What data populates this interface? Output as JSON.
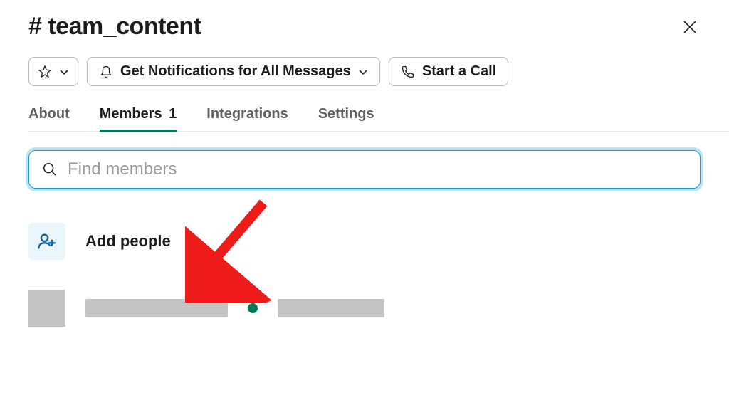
{
  "header": {
    "channel_name": "# team_content"
  },
  "toolbar": {
    "notifications_label": "Get Notifications for All Messages",
    "call_label": "Start a Call"
  },
  "tabs": {
    "about": "About",
    "members_label": "Members",
    "members_count": "1",
    "integrations": "Integrations",
    "settings": "Settings",
    "active_index": 1
  },
  "search": {
    "placeholder": "Find members"
  },
  "actions": {
    "add_people": "Add people"
  },
  "members": [
    {
      "presence": "active"
    }
  ]
}
